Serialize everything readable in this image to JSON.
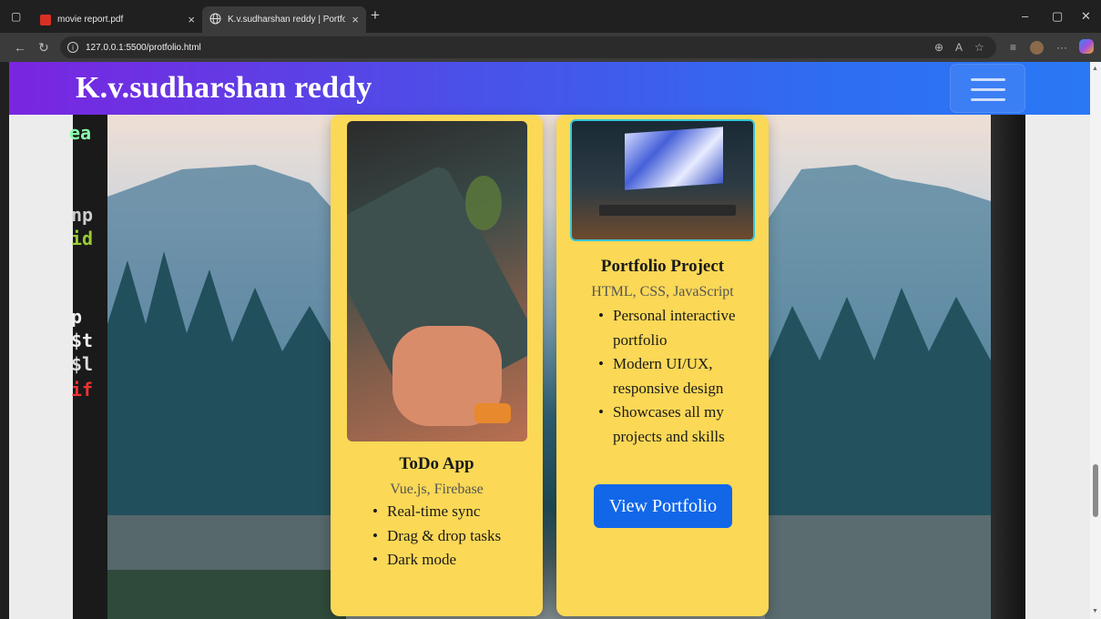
{
  "browser": {
    "tabs": [
      {
        "title": "movie report.pdf",
        "icon": "pdf-icon"
      },
      {
        "title": "K.v.sudharshan reddy | Portfolio",
        "icon": "globe-icon"
      }
    ],
    "new_tab_symbol": "+",
    "close_symbol": "×",
    "url": "127.0.0.1:5500/protfolio.html"
  },
  "site": {
    "brand": "K.v.sudharshan reddy",
    "menu_icon": "hamburger-icon",
    "accent_color": "#2a78f5",
    "card_color": "#fbd856",
    "button_color": "#1167e8"
  },
  "projects": [
    {
      "title": "ToDo App",
      "tech": "Vue.js, Firebase",
      "features": [
        "Real-time sync",
        "Drag & drop tasks",
        "Dark mode"
      ]
    },
    {
      "title": "Portfolio Project",
      "tech": "HTML, CSS, JavaScript",
      "features": [
        "Personal interactive portfolio",
        "Modern UI/UX, responsive design",
        "Showcases all my projects and skills"
      ],
      "button": "View Portfolio"
    }
  ]
}
